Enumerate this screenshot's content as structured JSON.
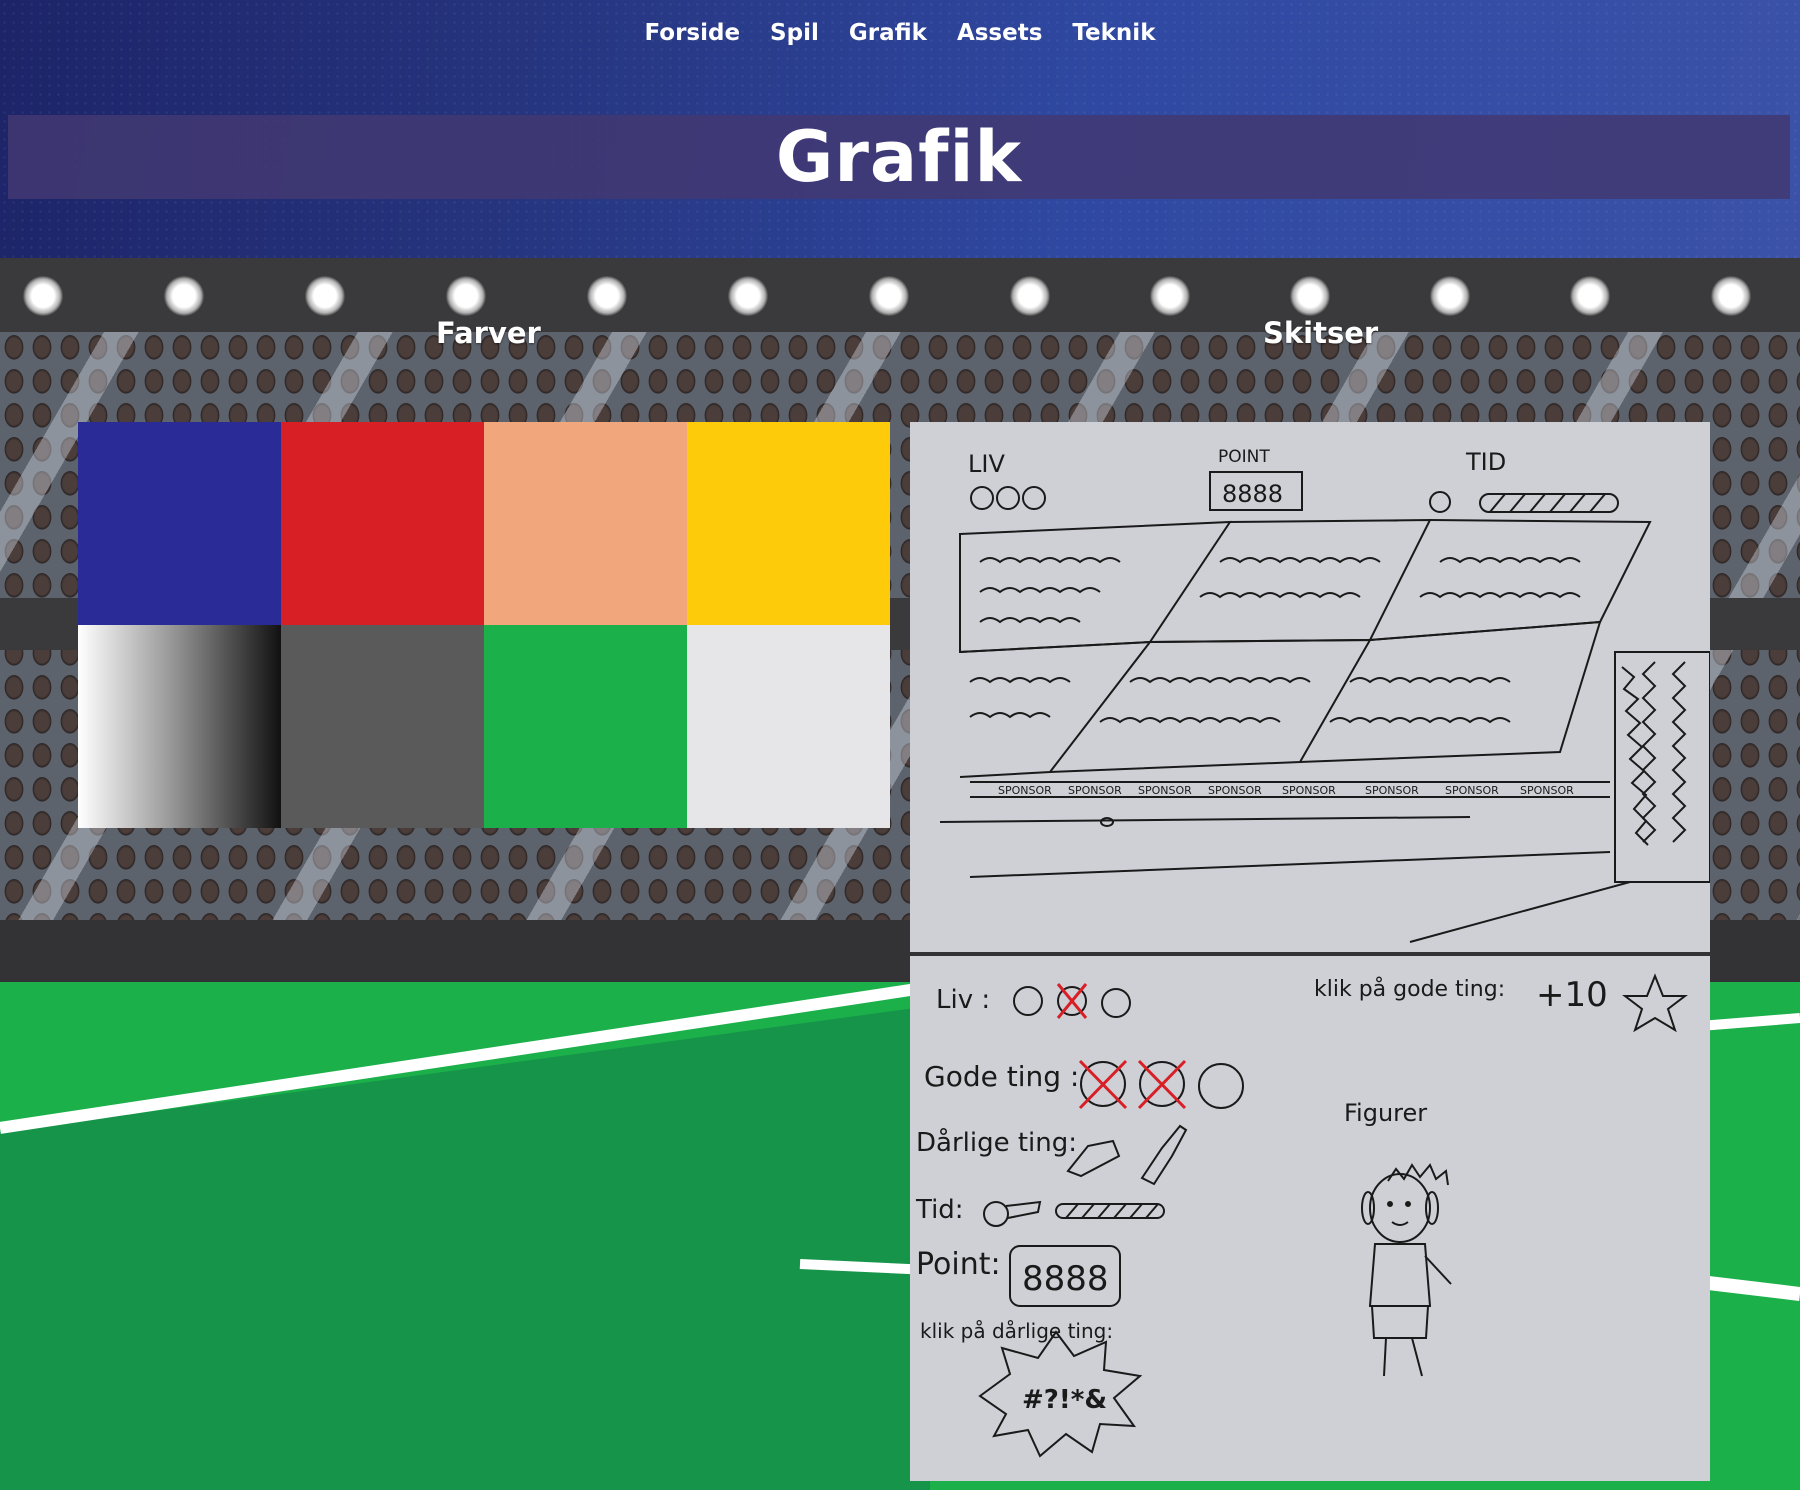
{
  "nav": {
    "items": [
      "Forside",
      "Spil",
      "Grafik",
      "Assets",
      "Teknik"
    ]
  },
  "page": {
    "title": "Grafik"
  },
  "sections": {
    "colors_heading": "Farver",
    "sketches_heading": "Skitser"
  },
  "palette": {
    "colors": [
      "#2a2b96",
      "#d81f26",
      "#f2a67c",
      "#fdcb0a",
      "gradient-white-to-black",
      "#5a5a5a",
      "#1cb04b",
      "#e6e6e8"
    ]
  },
  "sketch_top": {
    "labels": {
      "lives": "LIV",
      "points": "POINT",
      "time": "TID",
      "score": "8888",
      "sponsor": "SPONSOR"
    }
  },
  "sketch_bottom": {
    "labels": {
      "lives": "Liv :",
      "click_good": "klik på gode ting:",
      "plus_ten": "+10",
      "good_things": "Gode ting :",
      "figures": "Figurer",
      "bad_things": "Dårlige ting:",
      "time": "Tid:",
      "points": "Point:",
      "score": "8888",
      "click_bad": "klik på dårlige ting:",
      "curse": "#?!*&"
    }
  }
}
